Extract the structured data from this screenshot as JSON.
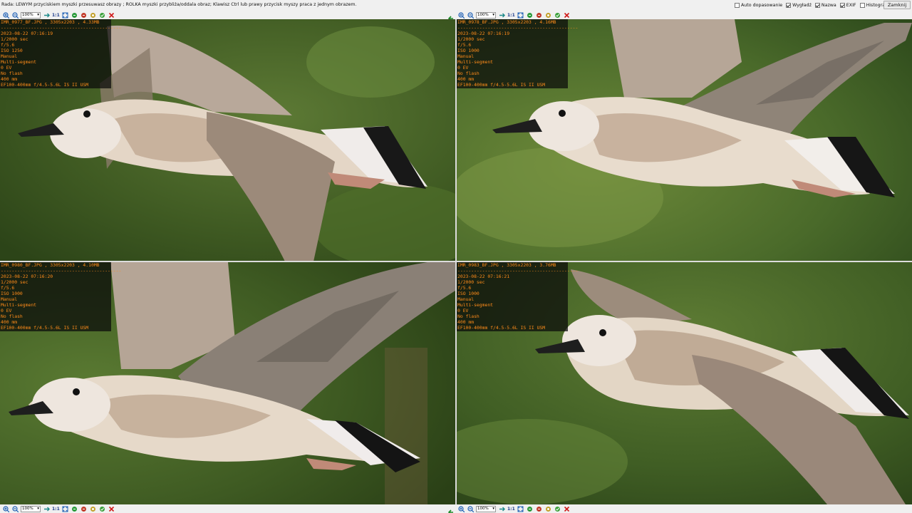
{
  "topbar": {
    "hint": "Rada: LEWYM przyciskiem myszki przesuwasz obrazy ; ROLKA myszki przybliża/oddala obraz; Klawisz Ctrl lub prawy przycisk myszy praca z jednym obrazem.",
    "options": [
      {
        "label": "Auto dopasowanie",
        "checked": false
      },
      {
        "label": "Wygładź",
        "checked": true
      },
      {
        "label": "Nazwa",
        "checked": true
      },
      {
        "label": "EXIF",
        "checked": true
      },
      {
        "label": "Histogram",
        "checked": false
      },
      {
        "label": "+",
        "checked": false
      }
    ],
    "close_label": "Zamknij"
  },
  "toolbar": {
    "zoom": "100%",
    "one_to_one": "1:1",
    "icons": [
      "zoom-in-icon",
      "zoom-out-icon",
      "fit-icon",
      "sync-icon",
      "rotate-left-icon",
      "rotate-right-icon",
      "save-icon",
      "copy-icon",
      "close-icon"
    ]
  },
  "panels": [
    {
      "title": "IMR_0977_BF.JPG , 3305x2203 , 4.33MB",
      "separator": "--------------------------------------------",
      "exif": [
        "2023-08-22 07:16:19",
        "1/2000 sec",
        "f/5.6",
        "ISO 1250",
        "Manual",
        "Multi-segment",
        "0 EV",
        "No flash",
        "400 mm",
        "EF100-400mm f/4.5-5.6L IS II USM"
      ]
    },
    {
      "title": "IMR_0978_BF.JPG , 3305x2203 , 4.16MB",
      "separator": "--------------------------------------------",
      "exif": [
        "2023-08-22 07:16:19",
        "1/2000 sec",
        "f/5.6",
        "ISO 1000",
        "Manual",
        "Multi-segment",
        "0 EV",
        "No flash",
        "400 mm",
        "EF100-400mm f/4.5-5.6L IS II USM"
      ]
    },
    {
      "title": "IMR_0980_BF.JPG , 3305x2203 , 4.10MB",
      "separator": "--------------------------------------------",
      "exif": [
        "2023-08-22 07:16:20",
        "1/2000 sec",
        "f/5.6",
        "ISO 1000",
        "Manual",
        "Multi-segment",
        "0 EV",
        "No flash",
        "400 mm",
        "EF100-400mm f/4.5-5.6L IS II USM"
      ]
    },
    {
      "title": "IMR_0983_BF.JPG , 3305x2203 , 3.76MB",
      "separator": "--------------------------------------------",
      "exif": [
        "2023-08-22 07:16:21",
        "1/2000 sec",
        "f/5.6",
        "ISO 1000",
        "Manual",
        "Multi-segment",
        "0 EV",
        "No flash",
        "400 mm",
        "EF100-400mm f/4.5-5.6L IS II USM"
      ]
    }
  ],
  "colors": {
    "exif_text": "#ff8c1a",
    "background_green": "#4a6a2e",
    "bird_body": "#e8dccc",
    "bird_brown": "#9a7a62",
    "wing_tip": "#1a1a1a"
  }
}
